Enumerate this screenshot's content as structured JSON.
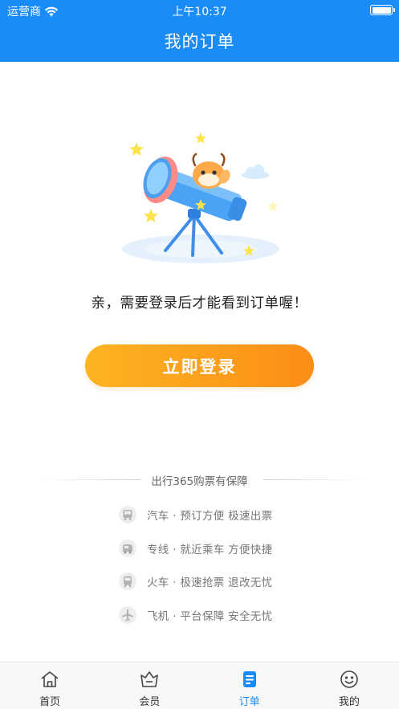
{
  "status_bar": {
    "carrier": "运营商",
    "time": "上午10:37"
  },
  "header": {
    "title": "我的订单"
  },
  "empty_state": {
    "message": "亲，需要登录后才能看到订单喔！",
    "login_button": "立即登录"
  },
  "guarantee": {
    "title": "出行365购票有保障",
    "items": [
      {
        "icon": "bus-icon",
        "text": "汽车 · 预订方便  极速出票"
      },
      {
        "icon": "shuttle-icon",
        "text": "专线 · 就近乘车  方便快捷"
      },
      {
        "icon": "train-icon",
        "text": "火车 · 极速抢票  退改无忧"
      },
      {
        "icon": "plane-icon",
        "text": "飞机 · 平台保障  安全无忧"
      }
    ]
  },
  "tabbar": {
    "items": [
      {
        "label": "首页",
        "icon": "home-icon",
        "active": false
      },
      {
        "label": "会员",
        "icon": "member-icon",
        "active": false
      },
      {
        "label": "订单",
        "icon": "order-icon",
        "active": true
      },
      {
        "label": "我的",
        "icon": "profile-icon",
        "active": false
      }
    ]
  },
  "colors": {
    "brand_blue": "#1a8cf8",
    "button_start": "#fdb422",
    "button_end": "#fb8d17"
  }
}
